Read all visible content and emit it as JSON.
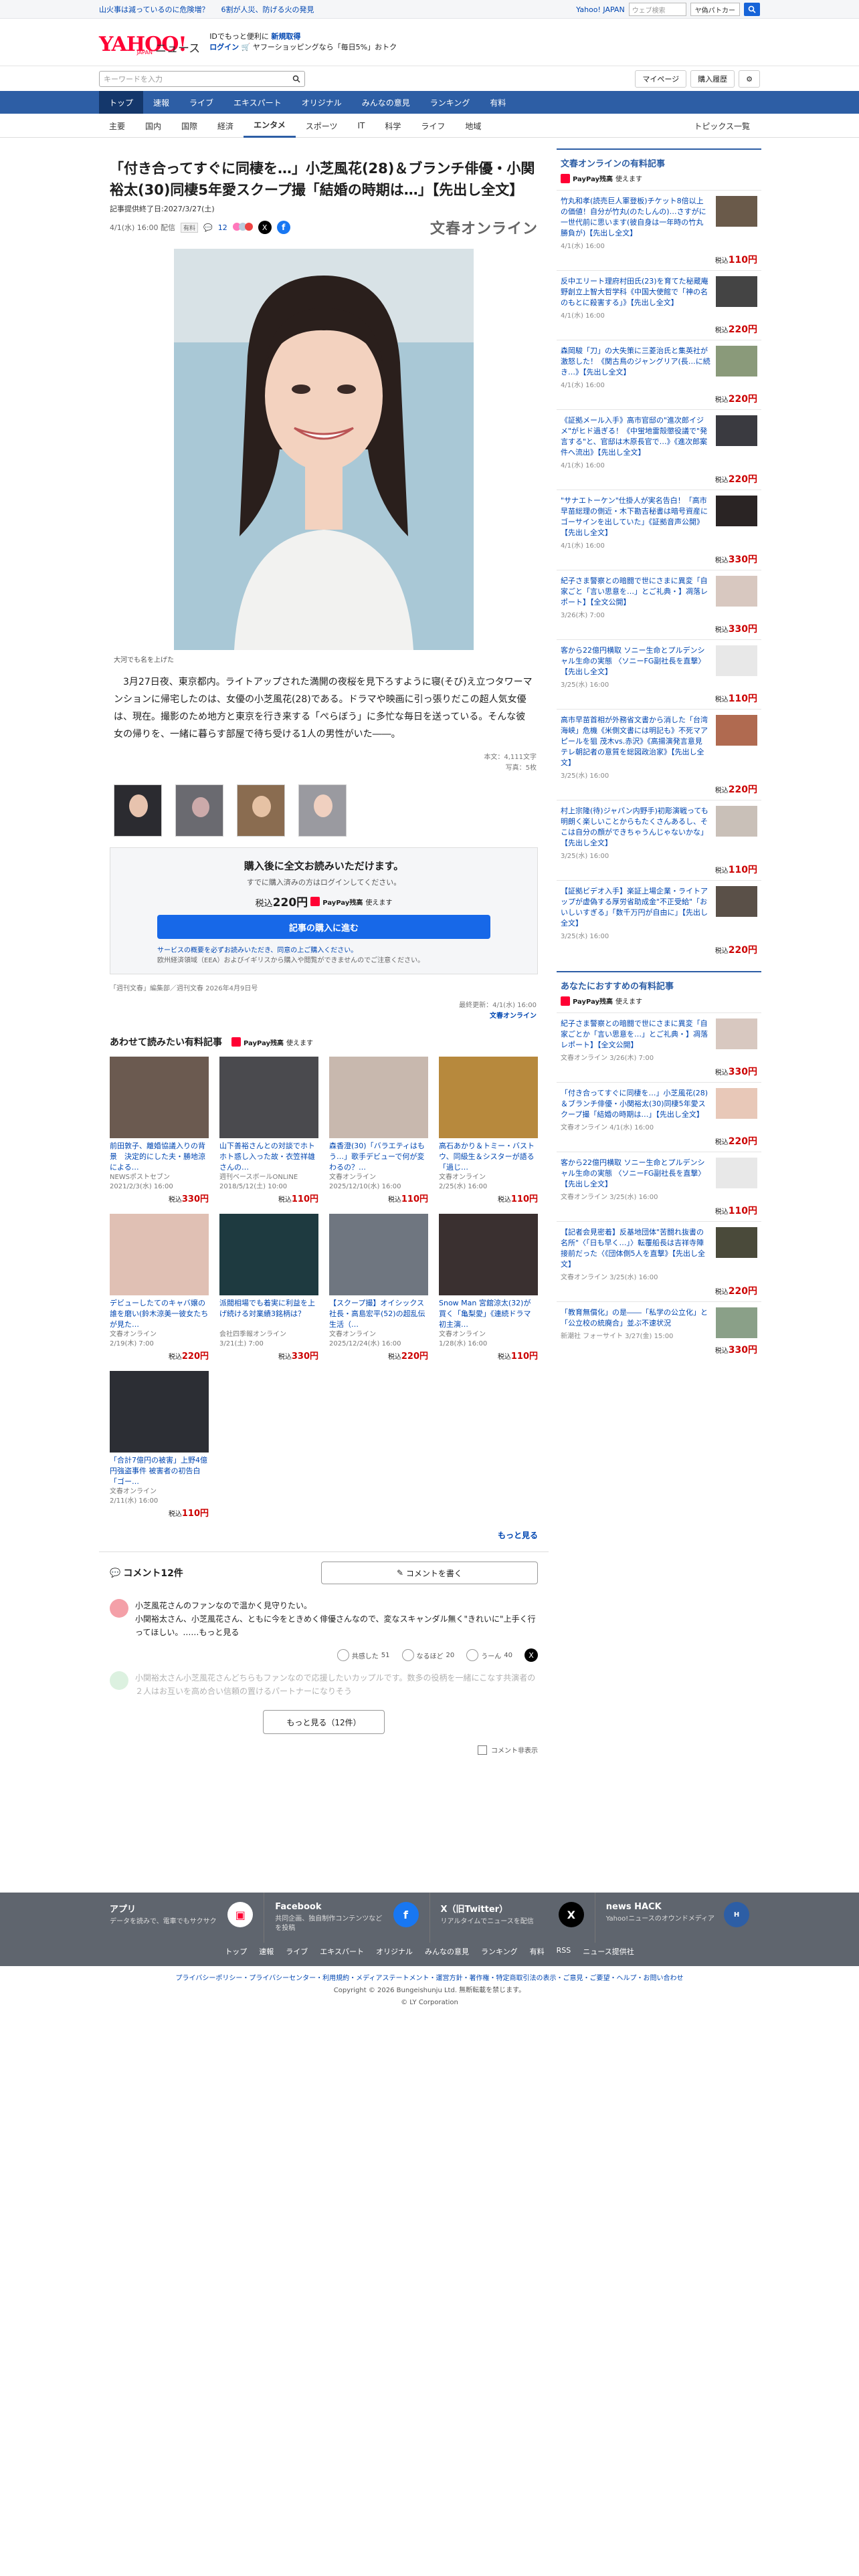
{
  "topbar": {
    "links": [
      "山火事は減っているのに危険増？",
      "6割が人災、防げる火の発見"
    ],
    "right_link": "Yahoo! JAPAN",
    "search_placeholder": "ウェブ検索",
    "button": "ヤ偽パトカー"
  },
  "header": {
    "logo_main": "YAHOO!",
    "logo_sub": "JAPAN",
    "logo_section": "ニュース",
    "promo_line1_a": "IDでもっと便利に",
    "promo_line1_b": "新規取得",
    "promo_line2_a": "ログイン",
    "promo_line2_b": "ヤフーショッピングなら「毎日5%」おトク"
  },
  "search": {
    "placeholder": "キーワードを入力",
    "mypage": "マイページ",
    "history": "購入履歴"
  },
  "nav": [
    "トップ",
    "速報",
    "ライブ",
    "エキスパート",
    "オリジナル",
    "みんなの意見",
    "ランキング",
    "有料"
  ],
  "subnav": [
    "主要",
    "国内",
    "国際",
    "経済",
    "エンタメ",
    "スポーツ",
    "IT",
    "科学",
    "ライフ",
    "地域"
  ],
  "subnav_right": "トピックス一覧",
  "article": {
    "title": "「付き合ってすぐに同棲を…」小芝風花(28)＆ブランチ俳優・小関裕太(30)同棲5年愛スクープ撮「結婚の時期は…」【先出し全文】",
    "period": "記事提供終了日:2027/3/27(土)",
    "date": "4/1(水) 16:00 配信",
    "badge": "有料",
    "comments": "12",
    "brand": "文春オンライン",
    "caption": "大河でも名を上げた",
    "body": "3月27日夜、東京都内。ライトアップされた満開の夜桜を見下ろすように寝(そび)え立つタワーマンションに帰宅したのは、女優の小芝風花(28)である。ドラマや映画に引っ張りだこの超人気女優は、現在。撮影のため地方と東京を行き来する「ぺらぼう」に多忙な毎日を送っている。そんな彼女の帰りを、一緒に暮らす部屋で待ち受ける1人の男性がいた――。",
    "chars": "本文：4,111文字",
    "photos": "写真：5枚",
    "buy_title": "購入後に全文お読みいただけます。",
    "buy_sub": "すでに購入済みの方はログインしてください。",
    "price_label": "税込",
    "price": "220円",
    "paypay": "PayPay残高",
    "paypay_use": "使えます",
    "buy_button": "記事の購入に進む",
    "notice1": "サービスの概要を必ずお読みいただき、同意の上ご購入ください。",
    "notice2": "欧州経済領域（EEA）およびイギリスから購入や閲覧ができませんのでご注意ください。",
    "source": "「週刊文春」編集部／週刊文春 2026年4月9日号",
    "updated": "最終更新：4/1(水) 16:00",
    "updated_brand": "文春オンライン"
  },
  "related": {
    "heading": "あわせて読みたい有料記事",
    "paypay": "PayPay残高",
    "paypay_use": "使えます",
    "items": [
      {
        "title": "前田敦子、離婚協議入りの背景　決定的にした夫・勝地涼による…",
        "src": "NEWSポストセブン",
        "date": "2021/2/3(水) 16:00",
        "price": "330円"
      },
      {
        "title": "山下善裕さんとの対談でホトホト惑し入った故・衣笠祥雄さんの…",
        "src": "週刊ベースボールONLINE",
        "date": "2018/5/12(土) 10:00",
        "price": "110円"
      },
      {
        "title": "森香澄(30)「バラエティはもう…」歌手デビューで何が変わるの？…",
        "src": "文春オンライン",
        "date": "2025/12/10(水) 16:00",
        "price": "110円"
      },
      {
        "title": "高石あかり＆トミー・バストウ、同級生＆シスターが語る「過じ…",
        "src": "文春オンライン",
        "date": "2/25(水) 16:00",
        "price": "110円"
      },
      {
        "title": "デビューしたてのキャバ嬢の誰を磨い(鈴木涼美一彼女たちが見た…",
        "src": "文春オンライン",
        "date": "2/19(木) 7:00",
        "price": "220円"
      },
      {
        "title": "派閥相場でも着実に利益を上げ続ける対業績3銘柄は？",
        "src": "会社四季報オンライン",
        "date": "3/21(土) 7:00",
        "price": "330円"
      },
      {
        "title": "【スクープ撮】オイシックス社長・高島宏平(52)の超乱伝生活（…",
        "src": "文春オンライン",
        "date": "2025/12/24(水) 16:00",
        "price": "220円"
      },
      {
        "title": "Snow Man 宮舘涼太(32)が買く「亀梨愛」《連続ドラマ初主演…",
        "src": "文春オンライン",
        "date": "1/28(水) 16:00",
        "price": "110円"
      },
      {
        "title": "「合計7億円の被害」上野4億円強盗事件 被害者の初告白「ゴー…",
        "src": "文春オンライン",
        "date": "2/11(水) 16:00",
        "price": "110円"
      }
    ],
    "more": "もっと見る"
  },
  "comments": {
    "title": "コメント12件",
    "write": "コメントを書く",
    "c1": "小芝風花さんのファンなので温かく見守りたい。\n小関裕太さん、小芝風花さん、ともに今をときめく俳優さんなので、変なスキャンダル無く\"きれいに\"上手く行ってほしい。……もっと見る",
    "r1": "共感した",
    "r1n": "51",
    "r2": "なるほど",
    "r2n": "20",
    "r3": "うーん",
    "r3n": "40",
    "c2": "小関裕太さん小芝風花さんどちらもファンなので応援したいカップルです。数多の役柄を一緒にこなす共演者の２人はお互いを高め合い信頼の置けるパートナーになりそう",
    "more": "もっと見る（12件）",
    "hide": "コメント非表示"
  },
  "sidebar": {
    "heading1": "文春オンラインの有料記事",
    "paypay": "PayPay残高",
    "paypay_use": "使えます",
    "list1": [
      {
        "t": "竹丸和孝(読売巨人軍登板)チケット8倍以上の価値！自分が竹丸(のたしんの)…さすがに一世代前に思います(彼自身は一年時の竹丸勝負が)【先出し全文】",
        "d": "4/1(水) 16:00",
        "p": "110円"
      },
      {
        "t": "反中エリート理府村田氏(23)を育てた秘蔵庵野創立上智大哲学科《中国大使館で「神の名のもとに殺害する」》【先出し全文】",
        "d": "4/1(水) 16:00",
        "p": "220円"
      },
      {
        "t": "森岡駿「刀」の大失策に三菱治氏と集英社が激怒した！《関古鳥のジャングリア(長…に続き…》【先出し全文】",
        "d": "4/1(水) 16:00",
        "p": "220円"
      },
      {
        "t": "《証拠メール入手》高市官邸の\"進次郎イジメ\"がヒド過ぎる！《中蛍地雷殻懲役議で\"発言する\"と、官邸は木原長官で…》《進次郎案件へ流出》【先出し全文】",
        "d": "4/1(水) 16:00",
        "p": "220円"
      },
      {
        "t": "\"サナエトーケン\"仕掛人が実名告白！「高市早苗総理の側近・木下勘吉秘書は暗号資産にゴーサインを出していた」《証拠音声公開》【先出し全文】",
        "d": "4/1(水) 16:00",
        "p": "330円"
      },
      {
        "t": "紀子さま警察との暗闘で世にさまに異変「自家ごと「言い思意を…」とご礼典・】凋落レポート】【全文公開】",
        "d": "3/26(木) 7:00",
        "p": "330円"
      },
      {
        "t": "客から22億円横取 ソニー生命とプルデンシャル生命の実態 〈ソニーFG副社長を直撃〉【先出し全文】",
        "d": "3/25(水) 16:00",
        "p": "110円"
      },
      {
        "t": "高市早苗首相が外務省文書から消した「台湾海峡」危機《米側文書には明記も》不死マアピールを狙 茂木vs.赤沢》《高揚演発言意見 テレ朝記者の意質を総図政治家》【先出し全文】",
        "d": "3/25(水) 16:00",
        "p": "220円"
      },
      {
        "t": "村上宗隆(待)ジャパン内野手)初彫演戦っても明朗く楽しいことからもたくさんあるし、そこは自分の顔ができちゃうんじゃないかな」【先出し全文】",
        "d": "3/25(水) 16:00",
        "p": "110円"
      },
      {
        "t": "【証拠ビデオ入手】楽証上場企業・ライトアップが虚偽する厚労省助成金\"不正受給\"「おいしいすぎる」「数千万円が自由に」【先出し全文】",
        "d": "3/25(水) 16:00",
        "p": "220円"
      }
    ],
    "heading2": "あなたにおすすめの有料記事",
    "list2": [
      {
        "t": "紀子さま警察との暗闘で世にさまに異変「自家ごとか「言い思意を…」とご礼典・】凋落レポート】【全文公開】",
        "d": "文春オンライン 3/26(木) 7:00",
        "p": "330円"
      },
      {
        "t": "「付き合ってすぐに同棲を…」小芝風花(28)＆ブランチ俳優・小関裕太(30)同棲5年愛スクープ撮「結婚の時期は…」【先出し全文】",
        "d": "文春オンライン 4/1(水) 16:00",
        "p": "220円"
      },
      {
        "t": "客から22億円横取 ソニー生命とプルデンシャル生命の実態 〈ソニーFG副社長を直撃〉【先出し全文】",
        "d": "文春オンライン 3/25(水) 16:00",
        "p": "110円"
      },
      {
        "t": "【記者会見密着】反基地団体\"苦闘れ抜書の名所\"〈「日も早く…」〉転覆船長は吉祥寺陣接前だった〈《団体側5人を直撃》【先出し全文】",
        "d": "文春オンライン 3/25(水) 16:00",
        "p": "220円"
      },
      {
        "t": "「教育無償化」の是――「私学の公立化」と「公立校の統廃合」並ぶ不速状況",
        "d": "新潮社 フォーサイト 3/27(金) 15:00",
        "p": "330円"
      }
    ]
  },
  "footer": {
    "cols": [
      {
        "t": "アプリ",
        "d": "データを読みで、電車でもサクサク"
      },
      {
        "t": "Facebook",
        "d": "共同企画、独自制作コンテンツなどを投稿"
      },
      {
        "t": "X（旧Twitter）",
        "d": "リアルタイムでニュースを配信"
      },
      {
        "t": "news HACK",
        "d": "Yahoo!ニュースのオウンドメディア"
      }
    ],
    "links": [
      "トップ",
      "速報",
      "ライブ",
      "エキスパート",
      "オリジナル",
      "みんなの意見",
      "ランキング",
      "有料",
      "RSS",
      "ニュース提供社"
    ],
    "legal_links": "プライバシーポリシー・プライバシーセンター・利用規約・メディアステートメント・運営方針・著作権・特定商取引法の表示・ご意見・ご要望・ヘルプ・お問い合わせ",
    "copyright": "Copyright © 2026 Bungeishunju Ltd. 無断転載を禁じます。",
    "ly": "© LY Corporation"
  }
}
